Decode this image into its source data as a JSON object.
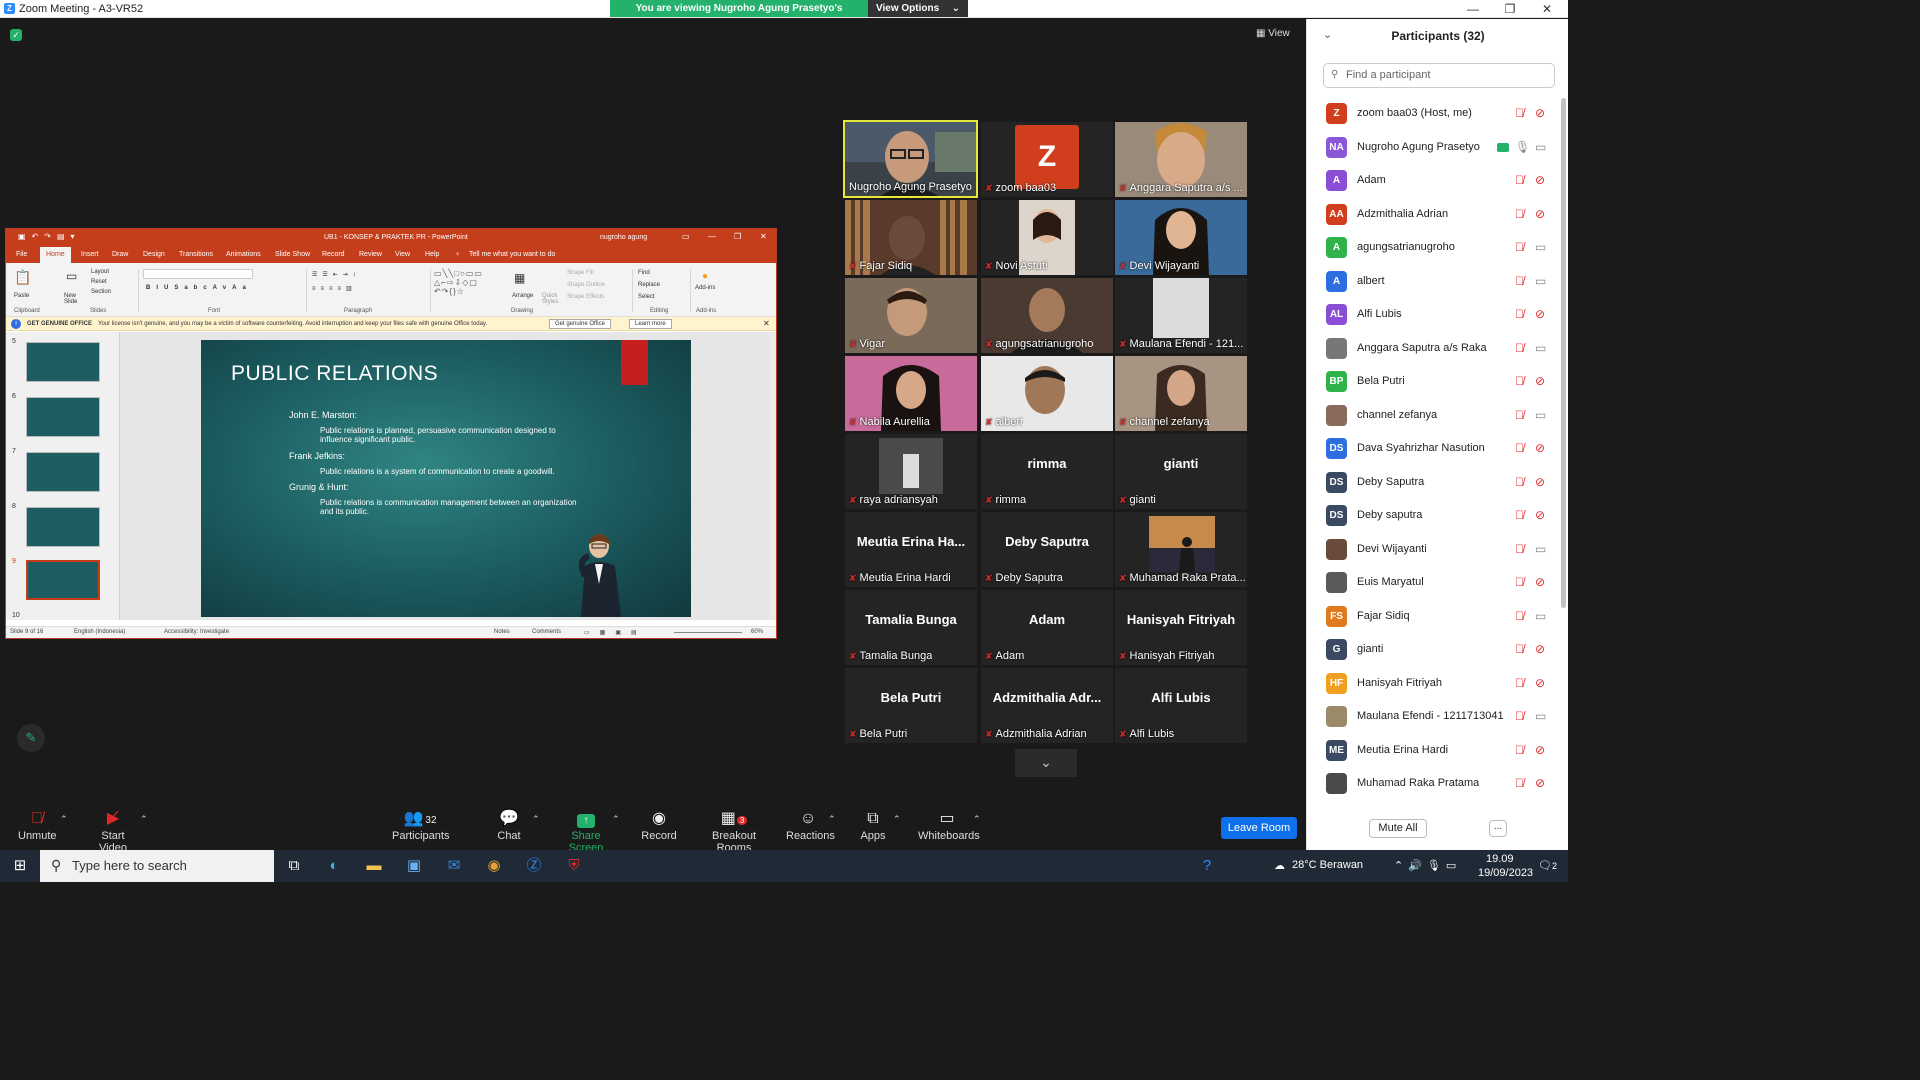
{
  "window": {
    "title": "Zoom Meeting - A3-VR52",
    "minimize": "—",
    "maximize": "❐",
    "close": "✕"
  },
  "banner": {
    "message": "You are viewing Nugroho Agung Prasetyo's screen",
    "options": "View Options"
  },
  "view_label": "View",
  "ppt": {
    "title": "UB1 - KONSEP & PRAKTEK PR  -  PowerPoint",
    "user": "nugroho agung",
    "tabs": [
      "File",
      "Home",
      "Insert",
      "Draw",
      "Design",
      "Transitions",
      "Animations",
      "Slide Show",
      "Record",
      "Review",
      "View",
      "Help"
    ],
    "tell_me": "Tell me what you want to do",
    "ribbon": {
      "paste": "Paste",
      "new_slide": "New Slide",
      "layout": "Layout",
      "reset": "Reset",
      "section": "Section",
      "arrange": "Arrange",
      "quick_styles": "Quick Styles",
      "shape_fill": "Shape Fill",
      "shape_outline": "Shape Outline",
      "shape_effects": "Shape Effects",
      "find": "Find",
      "replace": "Replace",
      "select": "Select",
      "addins": "Add-ins",
      "groups": [
        "Clipboard",
        "Slides",
        "Font",
        "Paragraph",
        "Drawing",
        "Editing",
        "Add-ins"
      ]
    },
    "warning": {
      "label": "GET GENUINE OFFICE",
      "text": "Your license isn't genuine, and you may be a victim of software counterfeiting. Avoid interruption and keep your files safe with genuine Office today.",
      "btn1": "Get genuine Office",
      "btn2": "Learn more"
    },
    "thumb_numbers": [
      "5",
      "6",
      "7",
      "8",
      "9",
      "10"
    ],
    "slide": {
      "title": "PUBLIC RELATIONS",
      "b1": "John E. Marston:",
      "b1s": "Public relations is planned, persuasive communication designed to influence significant public.",
      "b2": "Frank Jefkins:",
      "b2s": "Public relations is a system of communication to create a goodwill.",
      "b3": "Grunig & Hunt:",
      "b3s": "Public relations is communication management between an organization and its public."
    },
    "status": {
      "slide": "Slide 9 of 16",
      "lang": "English (Indonesia)",
      "access": "Accessibility: Investigate",
      "notes": "Notes",
      "comments": "Comments",
      "zoom": "60%"
    }
  },
  "gallery": [
    {
      "name": "Nugroho Agung Prasetyo",
      "big": ""
    },
    {
      "name": "zoom baa03",
      "big": ""
    },
    {
      "name": "Anggara Saputra a/s ...",
      "big": ""
    },
    {
      "name": "Fajar Sidiq",
      "big": ""
    },
    {
      "name": "Novi Astuti",
      "big": ""
    },
    {
      "name": "Devi Wijayanti",
      "big": ""
    },
    {
      "name": "Vigar",
      "big": ""
    },
    {
      "name": "agungsatrianugroho",
      "big": ""
    },
    {
      "name": "Maulana Efendi - 121...",
      "big": ""
    },
    {
      "name": "Nabila Aurellia",
      "big": ""
    },
    {
      "name": "albert",
      "big": ""
    },
    {
      "name": "channel zefanya",
      "big": ""
    },
    {
      "name": "raya adriansyah",
      "big": ""
    },
    {
      "name": "rimma",
      "big": "rimma"
    },
    {
      "name": "gianti",
      "big": "gianti"
    },
    {
      "name": "Meutia Erina Hardi",
      "big": "Meutia Erina Ha..."
    },
    {
      "name": "Deby Saputra",
      "big": "Deby Saputra"
    },
    {
      "name": "Muhamad Raka Prata...",
      "big": ""
    },
    {
      "name": "Tamalia Bunga",
      "big": "Tamalia Bunga"
    },
    {
      "name": "Adam",
      "big": "Adam"
    },
    {
      "name": "Hanisyah Fitriyah",
      "big": "Hanisyah Fitriyah"
    },
    {
      "name": "Bela Putri",
      "big": "Bela Putri"
    },
    {
      "name": "Adzmithalia Adrian",
      "big": "Adzmithalia Adr..."
    },
    {
      "name": "Alfi Lubis",
      "big": "Alfi Lubis"
    }
  ],
  "zoom_avatar_letter": "Z",
  "toolbar": {
    "unmute": "Unmute",
    "start_video": "Start Video",
    "participants": "Participants",
    "participant_count": "32",
    "chat": "Chat",
    "share": "Share Screen",
    "record": "Record",
    "breakout": "Breakout Rooms",
    "breakout_badge": "3",
    "reactions": "Reactions",
    "apps": "Apps",
    "whiteboards": "Whiteboards",
    "leave": "Leave Room"
  },
  "panel": {
    "title": "Participants (32)",
    "search_placeholder": "Find a participant",
    "mute_all": "Mute All",
    "more": "...",
    "participants": [
      {
        "initials": "Z",
        "name": "zoom baa03 (Host, me)",
        "color": "#d13e1e",
        "cam": "off"
      },
      {
        "initials": "NA",
        "name": "Nugroho Agung Prasetyo",
        "color": "#8a57d6",
        "cam": "on"
      },
      {
        "initials": "A",
        "name": "Adam",
        "color": "#8a4ed6",
        "cam": "off"
      },
      {
        "initials": "AA",
        "name": "Adzmithalia Adrian",
        "color": "#d13e1e",
        "cam": "off"
      },
      {
        "initials": "A",
        "name": "agungsatrianugroho",
        "color": "#2fb24a",
        "cam": "on"
      },
      {
        "initials": "A",
        "name": "albert",
        "color": "#2d6fe0",
        "cam": "on"
      },
      {
        "initials": "AL",
        "name": "Alfi Lubis",
        "color": "#8a4ed6",
        "cam": "off"
      },
      {
        "initials": "",
        "name": "Anggara Saputra a/s Raka",
        "color": "#777777",
        "cam": "on"
      },
      {
        "initials": "BP",
        "name": "Bela Putri",
        "color": "#2fb24a",
        "cam": "off"
      },
      {
        "initials": "",
        "name": "channel zefanya",
        "color": "#8a6a5a",
        "cam": "on"
      },
      {
        "initials": "DS",
        "name": "Dava Syahrizhar Nasution",
        "color": "#2d6fe0",
        "cam": "off"
      },
      {
        "initials": "DS",
        "name": "Deby Saputra",
        "color": "#3b4a63",
        "cam": "off"
      },
      {
        "initials": "DS",
        "name": "Deby saputra",
        "color": "#3b4a63",
        "cam": "off"
      },
      {
        "initials": "",
        "name": "Devi Wijayanti",
        "color": "#6a4a3a",
        "cam": "on"
      },
      {
        "initials": "",
        "name": "Euis Maryatul",
        "color": "#5a5a5a",
        "cam": "off"
      },
      {
        "initials": "FS",
        "name": "Fajar Sidiq",
        "color": "#e07a1e",
        "cam": "on"
      },
      {
        "initials": "G",
        "name": "gianti",
        "color": "#3b4a63",
        "cam": "off"
      },
      {
        "initials": "HF",
        "name": "Hanisyah Fitriyah",
        "color": "#f0a020",
        "cam": "off"
      },
      {
        "initials": "",
        "name": "Maulana Efendi - 1211713041",
        "color": "#9a8a6a",
        "cam": "on"
      },
      {
        "initials": "ME",
        "name": "Meutia Erina Hardi",
        "color": "#3b4a63",
        "cam": "off"
      },
      {
        "initials": "",
        "name": "Muhamad Raka Pratama",
        "color": "#4a4a4a",
        "cam": "off"
      }
    ]
  },
  "taskbar": {
    "search": "Type here to search",
    "weather": "28°C  Berawan",
    "time": "19.09",
    "date": "19/09/2023",
    "notif": "2"
  }
}
